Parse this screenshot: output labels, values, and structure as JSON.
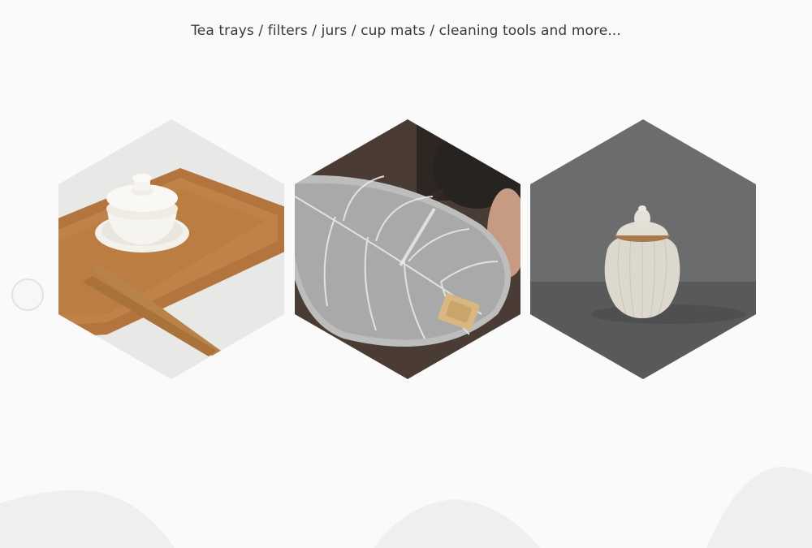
{
  "header": {
    "subtitle": "Tea trays / filters / jurs / cup mats / cleaning tools and more..."
  },
  "carousel": {
    "prev_icon": "circle-arrow-left-icon",
    "items": [
      {
        "name": "tea-tray-with-gaiwan-and-tongs"
      },
      {
        "name": "leaf-tea-filter"
      },
      {
        "name": "ceramic-tea-jar"
      }
    ]
  },
  "colors": {
    "background": "#f9faf9",
    "text": "#3a3a3a",
    "hill": "#efefef"
  }
}
